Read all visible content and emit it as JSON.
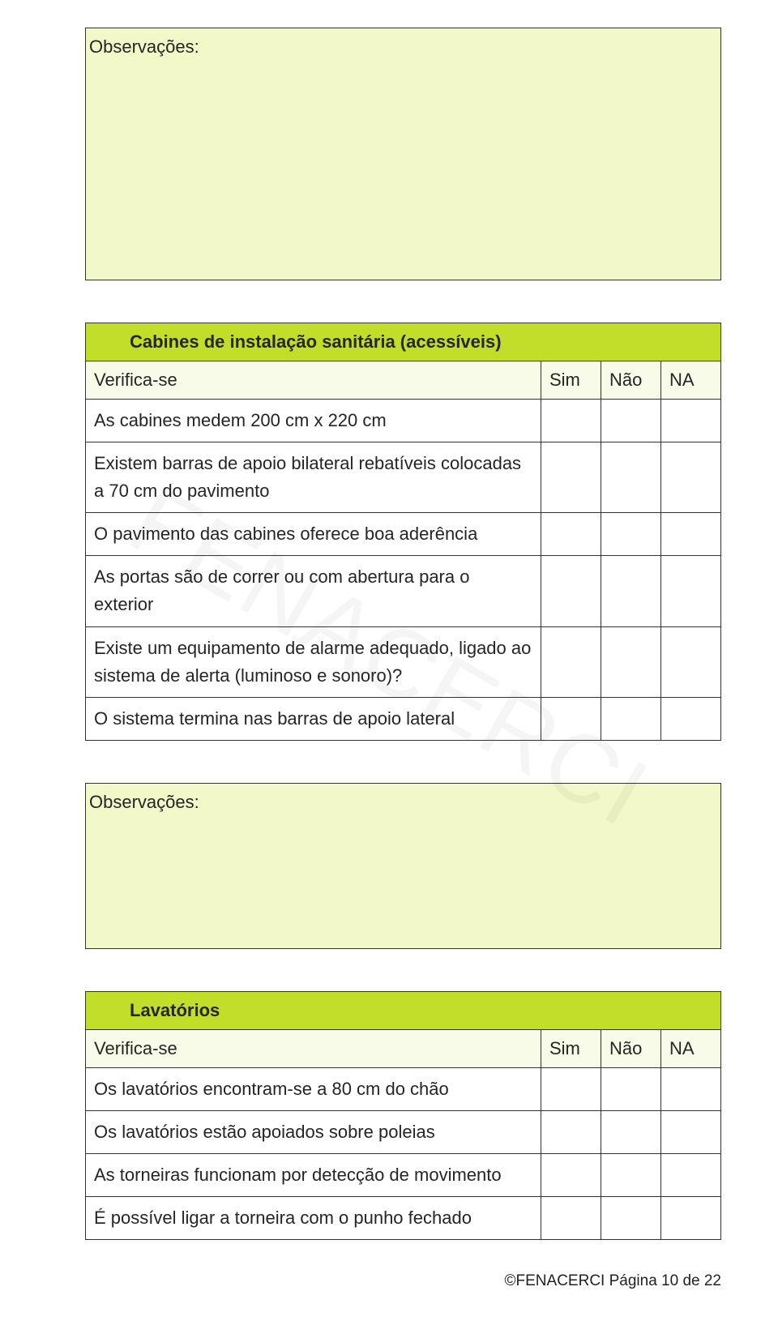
{
  "observations_label": "Observações:",
  "section1": {
    "title": "Cabines de instalação sanitária (acessíveis)",
    "subhead": {
      "q": "Verifica-se",
      "sim": "Sim",
      "nao": "Não",
      "na": "NA"
    },
    "rows": [
      "As cabines medem 200 cm x 220 cm",
      "Existem barras de apoio bilateral rebatíveis colocadas a 70 cm do pavimento",
      "O pavimento das cabines oferece boa aderência",
      "As portas são de correr ou com abertura para o exterior",
      "Existe um equipamento de alarme adequado, ligado ao sistema de alerta (luminoso e sonoro)?",
      "O sistema termina nas barras de apoio lateral"
    ]
  },
  "section2": {
    "title": "Lavatórios",
    "subhead": {
      "q": "Verifica-se",
      "sim": "Sim",
      "nao": "Não",
      "na": "NA"
    },
    "rows": [
      "Os lavatórios encontram-se a 80 cm do chão",
      "Os lavatórios estão apoiados sobre poleias",
      "As torneiras funcionam por detecção de movimento",
      "É possível ligar a torneira com o punho fechado"
    ]
  },
  "footer": "©FENACERCI Página 10 de 22"
}
